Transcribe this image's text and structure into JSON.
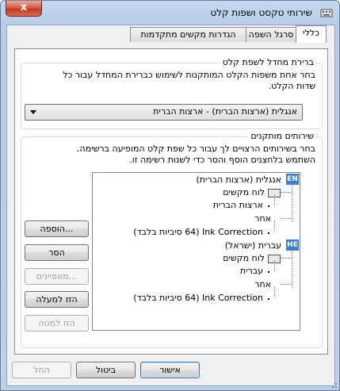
{
  "window": {
    "title": "שירותי טקסט ושפות קלט",
    "close_label": "x"
  },
  "tabs": [
    {
      "label": "כללי",
      "active": true
    },
    {
      "label": "סרגל השפה",
      "active": false
    },
    {
      "label": "הגדרות מקשים מתקדמות",
      "active": false
    }
  ],
  "default_language": {
    "group_title": "ברירת מחדל לשפת קלט",
    "description_line1": "בחר אחת משפות הקלט המותקנות לשימוש כברירת המחדל עבור כל",
    "description_line2": "שדות הקלט.",
    "selected_value": "אנגלית (ארצות הברית) - ארצות הברית"
  },
  "installed_services": {
    "group_title": "שירותים מותקנים",
    "description_line1": "בחר בשירותים הרצויים לך עבור כל שפת קלט המופיעה ברשימה.",
    "description_line2": "השתמש בלחצנים הוסף והסר כדי לשנות רשימה זו.",
    "tree": [
      {
        "type": "language",
        "badge": "EN",
        "label": "אנגלית (ארצות הברית)"
      },
      {
        "type": "category",
        "label": "לוח מקשים"
      },
      {
        "type": "item",
        "label": "ארצות הברית"
      },
      {
        "type": "category",
        "label": "אחר"
      },
      {
        "type": "item",
        "label": "Ink Correction (64 סיביות בלבד)"
      },
      {
        "type": "language",
        "badge": "HE",
        "label": "עברית (ישראל)"
      },
      {
        "type": "category",
        "label": "לוח מקשים"
      },
      {
        "type": "item",
        "label": "עברית"
      },
      {
        "type": "category",
        "label": "אחר"
      },
      {
        "type": "item",
        "label": "Ink Correction (64 סיביות בלבד)"
      }
    ],
    "buttons": {
      "add": "הוספה...",
      "remove": "הסר",
      "properties": "מאפיינים...",
      "move_up": "הזז למעלה",
      "move_down": "הזז למטה"
    }
  },
  "footer": {
    "ok": "אישור",
    "cancel": "ביטול",
    "apply": "החל"
  },
  "colors": {
    "accent": "#3c7fd0",
    "close_button": "#c23a22"
  }
}
